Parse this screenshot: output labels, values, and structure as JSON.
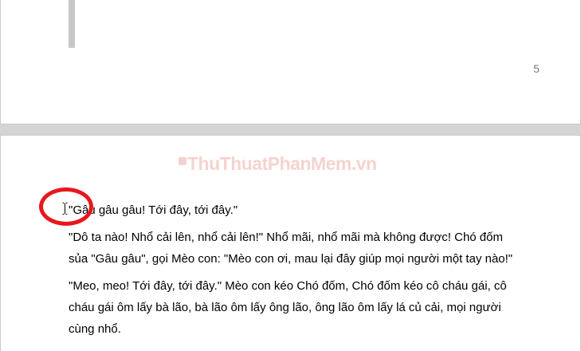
{
  "document": {
    "previous_page": {
      "page_number": "5"
    },
    "current_page": {
      "paragraphs": [
        {
          "line1": "\"Gâu gâu gâu! Tới đây, tới đây.\""
        },
        {
          "line1": "\"Dô ta nào! Nhổ cải lên, nhổ cải lên!\" Nhổ mãi, nhổ mãi mà không được! Chó đốm",
          "line2": "sủa \"Gâu gâu\", gọi Mèo con: \"Mèo con ơi, mau lại đây giúp mọi người một tay nào!\""
        },
        {
          "line1": "\"Meo, meo! Tới đây, tới đây.\" Mèo con kéo Chó đốm, Chó đốm kéo cô cháu gái, cô",
          "line2": "cháu gái ôm lấy bà lão, bà lão ôm lấy ông lão, ông lão ôm lấy lá củ cải, mọi người",
          "line3": "cùng nhổ."
        }
      ]
    }
  },
  "watermark": {
    "text": "ThuThuatPhanMem.vn",
    "color": "#e6968c"
  },
  "annotation": {
    "circle_color": "#e8171d"
  },
  "cursor": {
    "icon": "text-ibeam-cursor-icon"
  }
}
